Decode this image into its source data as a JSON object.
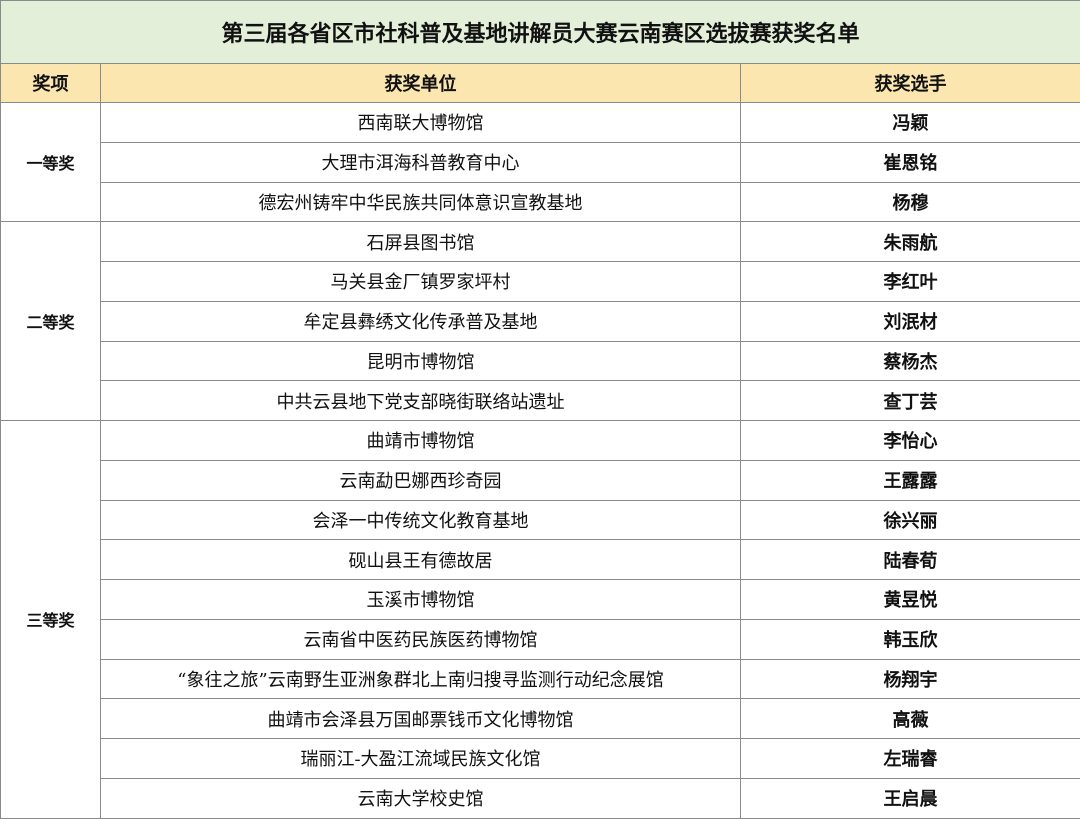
{
  "title": "第三届各省区市社科普及基地讲解员大赛云南赛区选拔赛获奖名单",
  "headers": {
    "award": "奖项",
    "unit": "获奖单位",
    "person": "获奖选手"
  },
  "groups": [
    {
      "award": "一等奖",
      "rows": [
        {
          "unit": "西南联大博物馆",
          "person": "冯颖"
        },
        {
          "unit": "大理市洱海科普教育中心",
          "person": "崔恩铭"
        },
        {
          "unit": "德宏州铸牢中华民族共同体意识宣教基地",
          "person": "杨穆"
        }
      ]
    },
    {
      "award": "二等奖",
      "rows": [
        {
          "unit": "石屏县图书馆",
          "person": "朱雨航"
        },
        {
          "unit": "马关县金厂镇罗家坪村",
          "person": "李红叶"
        },
        {
          "unit": "牟定县彝绣文化传承普及基地",
          "person": "刘泯材"
        },
        {
          "unit": "昆明市博物馆",
          "person": "蔡杨杰"
        },
        {
          "unit": "中共云县地下党支部晓街联络站遗址",
          "person": "查丁芸"
        }
      ]
    },
    {
      "award": "三等奖",
      "rows": [
        {
          "unit": "曲靖市博物馆",
          "person": "李怡心"
        },
        {
          "unit": "云南勐巴娜西珍奇园",
          "person": "王露露"
        },
        {
          "unit": "会泽一中传统文化教育基地",
          "person": "徐兴丽"
        },
        {
          "unit": "砚山县王有德故居",
          "person": "陆春荀"
        },
        {
          "unit": "玉溪市博物馆",
          "person": "黄昱悦"
        },
        {
          "unit": "云南省中医药民族医药博物馆",
          "person": "韩玉欣"
        },
        {
          "unit": "“象往之旅”云南野生亚洲象群北上南归搜寻监测行动纪念展馆",
          "person": "杨翔宇"
        },
        {
          "unit": "曲靖市会泽县万国邮票钱币文化博物馆",
          "person": "高薇"
        },
        {
          "unit": "瑞丽江-大盈江流域民族文化馆",
          "person": "左瑞睿"
        },
        {
          "unit": "云南大学校史馆",
          "person": "王启晨"
        }
      ]
    }
  ]
}
